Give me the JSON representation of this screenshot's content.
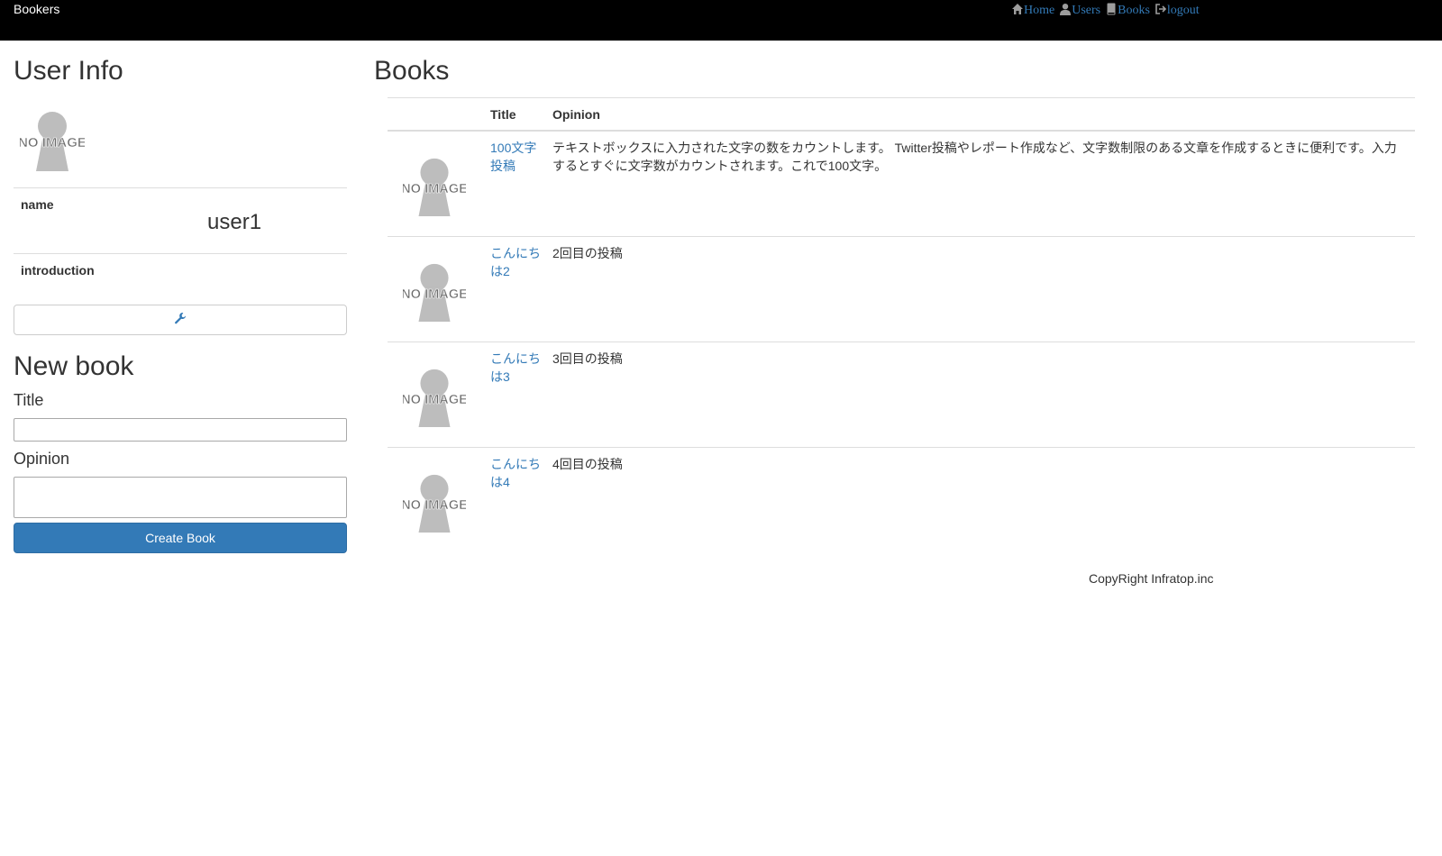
{
  "header": {
    "brand": "Bookers",
    "nav": [
      {
        "label": "Home",
        "icon": "home-icon"
      },
      {
        "label": "Users",
        "icon": "user-icon"
      },
      {
        "label": "Books",
        "icon": "book-icon"
      },
      {
        "label": "logout",
        "icon": "logout-icon"
      }
    ]
  },
  "user_info": {
    "heading": "User Info",
    "avatar_text": "NO IMAGE",
    "rows": [
      {
        "key": "name",
        "value": "user1"
      },
      {
        "key": "introduction",
        "value": ""
      }
    ],
    "edit_icon": "wrench-icon"
  },
  "new_book": {
    "heading": "New book",
    "title_label": "Title",
    "title_value": "",
    "opinion_label": "Opinion",
    "opinion_value": "",
    "submit_label": "Create Book"
  },
  "books": {
    "heading": "Books",
    "columns": [
      "",
      "Title",
      "Opinion"
    ],
    "image_text": "NO IMAGE",
    "rows": [
      {
        "title": "100文字投稿",
        "opinion": "テキストボックスに入力された文字の数をカウントします。 Twitter投稿やレポート作成など、文字数制限のある文章を作成するときに便利です。入力するとすぐに文字数がカウントされます。これで100文字。"
      },
      {
        "title": "こんにちは2",
        "opinion": "2回目の投稿"
      },
      {
        "title": "こんにちは3",
        "opinion": "3回目の投稿"
      },
      {
        "title": "こんにちは4",
        "opinion": "4回目の投稿"
      }
    ]
  },
  "footer": {
    "text": "CopyRight Infratop.inc"
  },
  "colors": {
    "header_bg": "#000000",
    "link": "#337ab7",
    "primary_button": "#337ab7",
    "border": "#dddddd"
  }
}
